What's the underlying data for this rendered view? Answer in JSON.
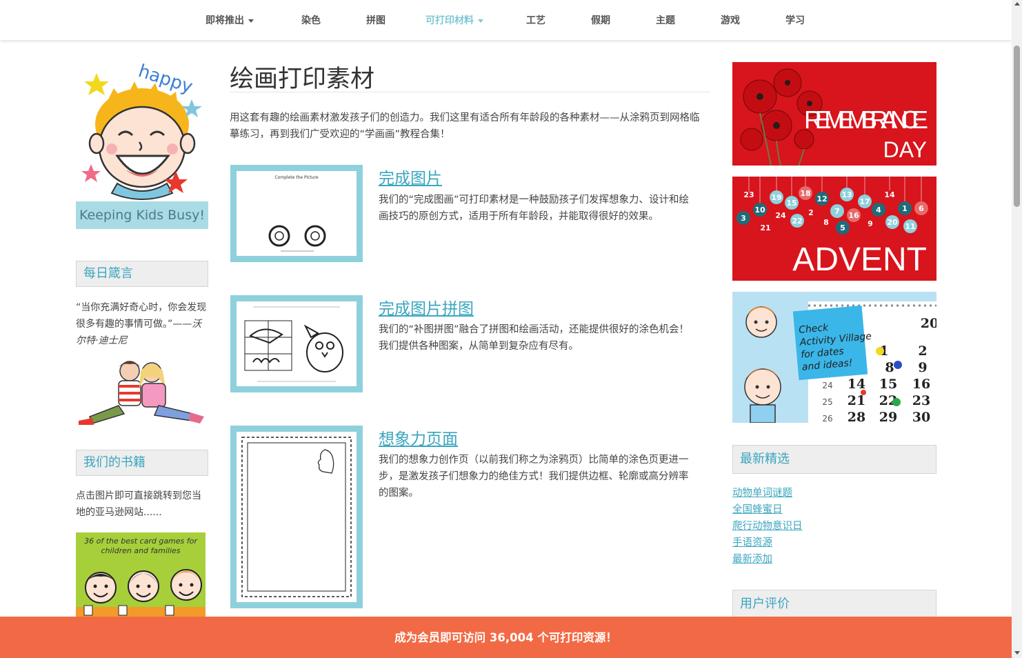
{
  "nav": {
    "items": [
      {
        "label": "即将推出",
        "dropdown": true,
        "active": false
      },
      {
        "label": "染色",
        "dropdown": false,
        "active": false
      },
      {
        "label": "拼图",
        "dropdown": false,
        "active": false
      },
      {
        "label": "可打印材料",
        "dropdown": true,
        "active": true
      },
      {
        "label": "工艺",
        "dropdown": false,
        "active": false
      },
      {
        "label": "假期",
        "dropdown": false,
        "active": false
      },
      {
        "label": "主题",
        "dropdown": false,
        "active": false
      },
      {
        "label": "游戏",
        "dropdown": false,
        "active": false
      },
      {
        "label": "学习",
        "dropdown": false,
        "active": false
      }
    ]
  },
  "left": {
    "logo_word": "happy",
    "logo_tagline": "Keeping Kids Busy!",
    "daily_quote_heading": "每日箴言",
    "quote_text": "“当你充满好奇心时，你会发现很多有趣的事情可做。”",
    "quote_author": "——沃尔特·迪士尼",
    "books_heading": "我们的书籍",
    "books_text": "点击图片即可直接跳转到您当地的亚马逊网站......",
    "book_title": "36 of the best card games for children and families"
  },
  "main": {
    "title": "绘画打印素材",
    "intro": "用这套有趣的绘画素材激发孩子们的创造力。我们这里有适合所有年龄段的各种素材——从涂鸦页到网格临摹练习，再到我们广受欢迎的“学画画”教程合集！",
    "entries": [
      {
        "title": "完成图片",
        "desc": "我们的“完成图画”可打印素材是一种鼓励孩子们发挥想象力、设计和绘画技巧的原创方式，适用于所有年龄段，并能取得很好的效果。",
        "thumb_caption": "Complete the Picture"
      },
      {
        "title": "完成图片拼图",
        "desc": "我们的“补图拼图”融合了拼图和绘画活动，还能提供很好的涂色机会！我们提供各种图案，从简单到复杂应有尽有。"
      },
      {
        "title": "想象力页面",
        "desc": "我们的想象力创作页（以前我们称之为涂鸦页）比简单的涂色页更进一步，是激发孩子们想象力的绝佳方式！我们提供边框、轮廓或高分辨率的图案。"
      }
    ]
  },
  "right": {
    "remembrance_line1": "REMEMBRANCE",
    "remembrance_line2": "DAY",
    "advent_label": "ADVENT",
    "calendar_note": [
      "Check",
      "Activity Village",
      "for dates",
      "and ideas!"
    ],
    "calendar_top_number": "20",
    "calendar_rows": [
      [
        "",
        "1",
        "2"
      ],
      [
        "",
        "8",
        "9"
      ],
      [
        "14",
        "15",
        "16"
      ],
      [
        "21",
        "22",
        "23"
      ],
      [
        "28",
        "29",
        "30"
      ]
    ],
    "calendar_side_numbers": [
      "24",
      "25",
      "26"
    ],
    "latest_heading": "最新精选",
    "latest_links": [
      "动物单词谜题",
      "全国蜂蜜日",
      "爬行动物意识日",
      "手语资源",
      "最新添加"
    ],
    "reviews_heading": "用户评价"
  },
  "bottom_bar": {
    "text": "成为会员即可访问 36,004 个可打印资源！"
  },
  "colors": {
    "accent": "#3aa6bf",
    "thumb_frame": "#8fd0dd",
    "banner_orange": "#f26a45",
    "promo_red": "#d8141c"
  }
}
